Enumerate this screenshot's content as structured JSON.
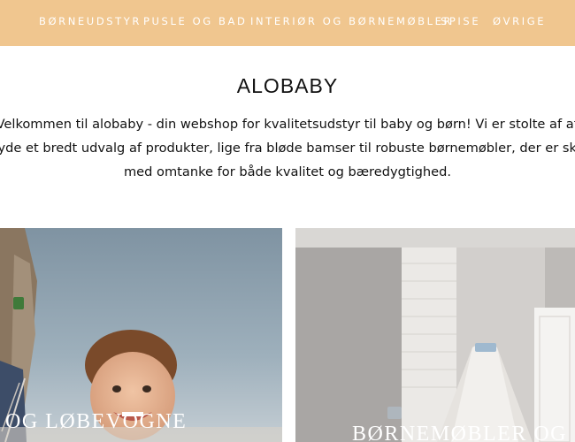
{
  "nav": {
    "items": [
      {
        "label": "BØRNEUDSTYR"
      },
      {
        "label": "PUSLE OG BAD"
      },
      {
        "label": "INTERIØR OG BØRNEMØBLER"
      },
      {
        "label": "SPISE"
      },
      {
        "label": "ØVRIGE"
      }
    ]
  },
  "header": {
    "title": "ALOBABY"
  },
  "intro": {
    "text": "Velkommen til alobaby - din webshop for kvalitetsudstyr til baby og børn! Vi er stolte af at tilbyde et bredt udvalg af produkter, lige fra bløde bamser til robuste børnemøbler, der er skabt med omtanke for både kvalitet og bæredygtighed."
  },
  "categories": [
    {
      "label": "OG LØBEVOGNE"
    },
    {
      "label": "BØRNEMØBLER OG"
    }
  ],
  "colors": {
    "nav_bg": "#f0c68f",
    "nav_text": "#ffffff"
  }
}
